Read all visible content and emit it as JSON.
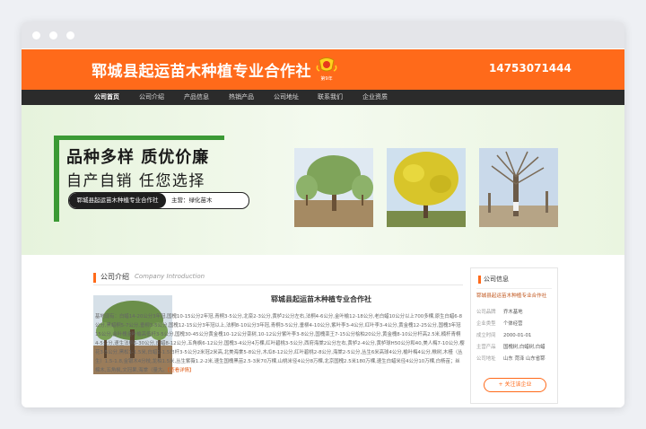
{
  "header": {
    "site_title": "郓城县起运苗木种植专业合作社",
    "badge_text": "第9年",
    "phone": "14753071444",
    "brand_color": "#ff6a1a"
  },
  "nav": {
    "items": [
      {
        "label": "公司首页"
      },
      {
        "label": "公司介绍"
      },
      {
        "label": "产品信息"
      },
      {
        "label": "热销产品"
      },
      {
        "label": "公司地址"
      },
      {
        "label": "联系我们"
      },
      {
        "label": "企业资质"
      }
    ]
  },
  "banner": {
    "slogan1": "品种多样 质优价廉",
    "slogan2": "自产自销 任您选择",
    "company": "郓城县起运苗木种植专业合作社",
    "main_business": "主营：绿化苗木"
  },
  "intro": {
    "title": "公司介绍",
    "subtitle": "Company Introduction",
    "company_name": "郓城县起运苗木种植专业合作社",
    "text": "基地现有：白蜡14-20公分3年冠,国槐10-15公分2年冠,青桐3-5公分,北栾2-3公分,黄栌2公分左右,法桐4-6公分,金叶榆12-18公分,老白蜡10公分以上700多棵,原生白蜡6-8公分,黑蜡桐5-7公分,垂柳3-5公分,国槐12-15公分3年冠以上,法桐8-10公分3年冠,青桐3-5公分,垂柳4-10公分,紫叶李3-4公分,红叶李3-4公分,黄金槐12-25公分,国槐3年冠15公分,金叶槐金叶榆高低杆3-5公分,国槐30-45公分黄金槐10-12公分栾树,10-12公分紫叶李3-8公分,国槐栾王7-15公分桧柏20公分,黄金槐8-10公分杆高2.5米,楠杆青桐4-5公分,速生法桐6-30公分,白蜡8-12公分,五角枫6-12公分,国槐3-4公分4万棵,红叶碧桃3-5公分,西府海棠2公分左右,黄栌2-4公分,黄栌球H50公分和40,美人梅7-10公分,樱花3-5公分,黑松1-1.5米,白蜡1-1.5白杆3-5公分2米冠2米高,北美海棠5-8公分,木瓜8-12公分,红叶碧桃2-8公分,海棠2-5公分,丛生6米高球4公分,榆叶梅4公分,楸树,木槿（丛生）1.5-1.8,金银木4分枝,龙柏1.5米,丛生紫薇1.2-2米,速生国槐黑苗2.5-3米70万棵,山桃米径4公分8万棵,北京国槐2.5米180万棵,速生白蜡米径4公分10万棵,白杨苗；丝棉木,五角枫,文冠果,海棠（量大。",
    "more": "【查看详情】"
  },
  "sidebar": {
    "title": "公司信息",
    "company_name": "郓城县起运苗木种植专业合作社",
    "rows": [
      {
        "key": "公司品牌",
        "value": "乔木基地"
      },
      {
        "key": "企业类型",
        "value": "个体经营"
      },
      {
        "key": "成立时间",
        "value": "2000-01-01"
      },
      {
        "key": "主营产品",
        "value": "国槐树,白蜡树,白蜡"
      },
      {
        "key": "公司地址",
        "value": "山东 菏泽 山东省郓"
      }
    ],
    "follow_label": "+ 关注该企业"
  }
}
